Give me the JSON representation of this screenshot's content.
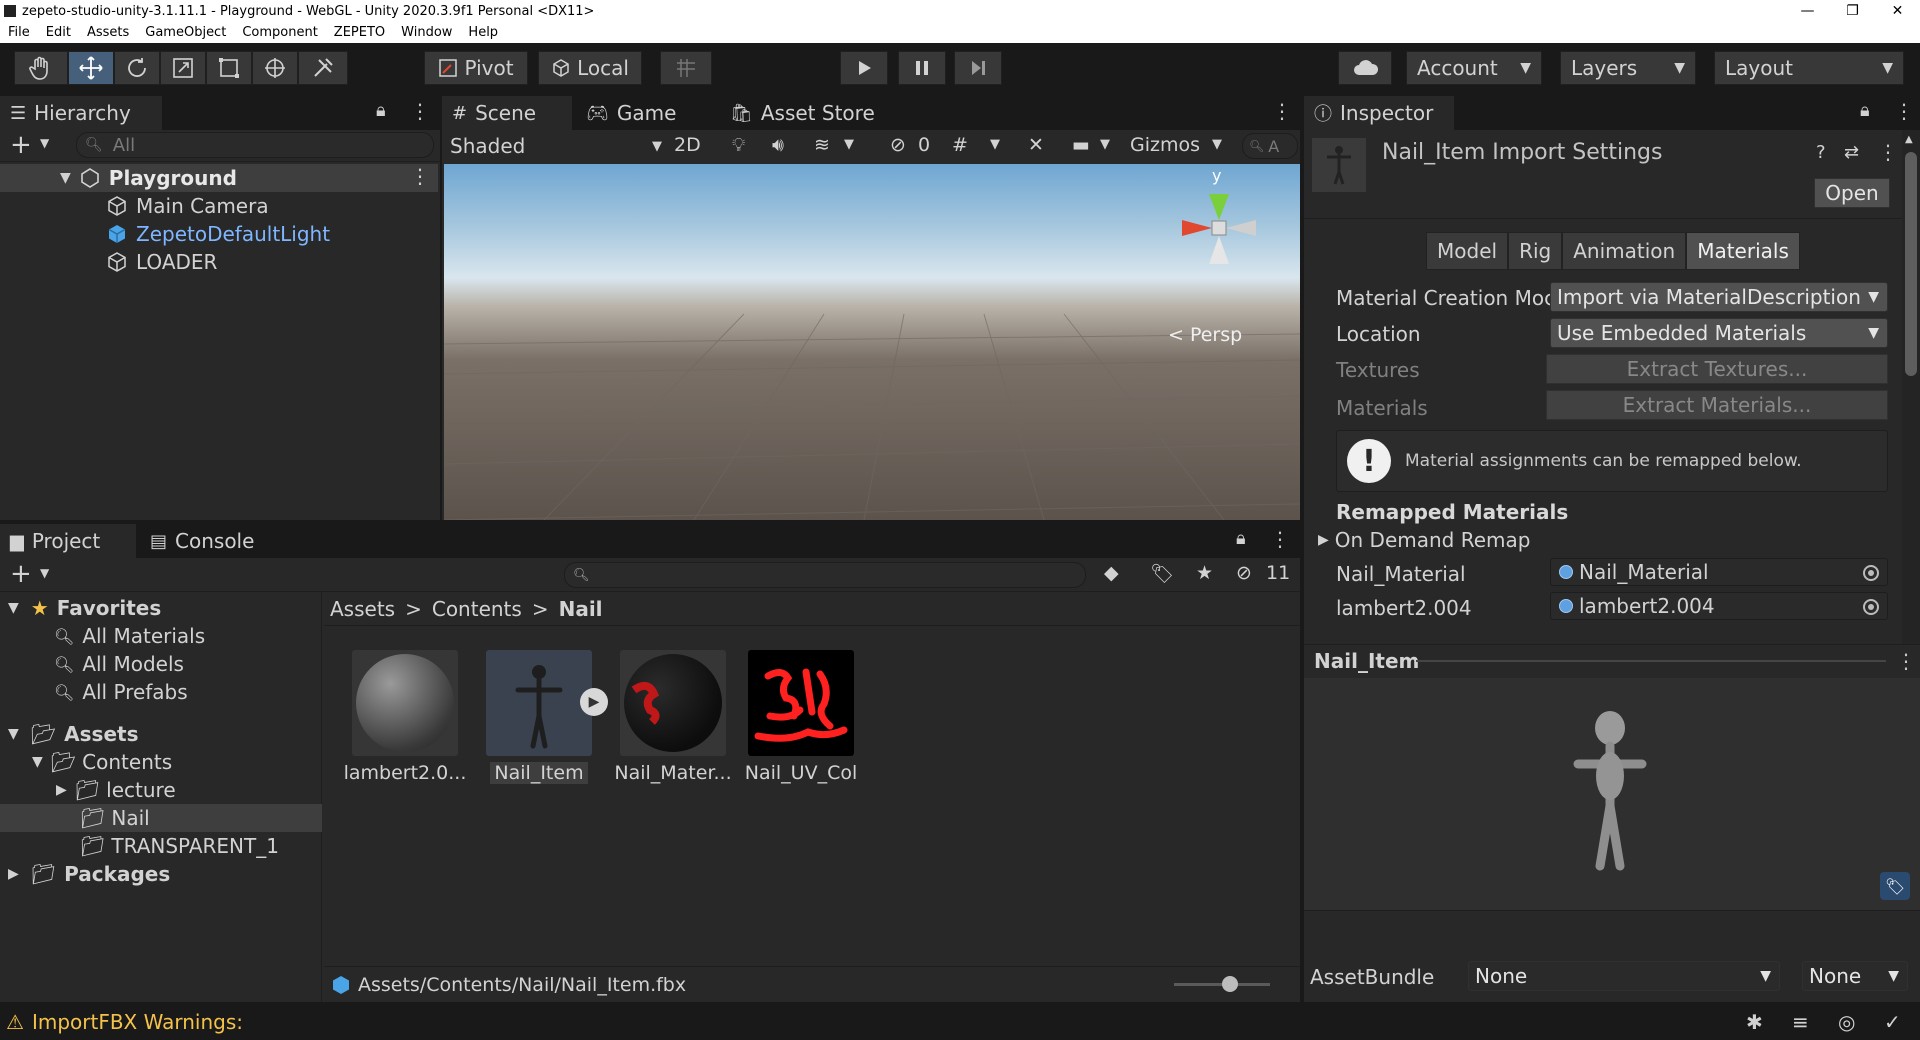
{
  "window": {
    "title": "zepeto-studio-unity-3.1.11.1 - Playground - WebGL - Unity 2020.3.9f1 Personal <DX11>",
    "minimize_glyph": "—",
    "restore_glyph": "❐",
    "close_glyph": "✕"
  },
  "menu": [
    "File",
    "Edit",
    "Assets",
    "GameObject",
    "Component",
    "ZEPETO",
    "Window",
    "Help"
  ],
  "toolbar": {
    "pivot_label": "Pivot",
    "local_label": "Local",
    "account_label": "Account",
    "layers_label": "Layers",
    "layout_label": "Layout"
  },
  "hierarchy": {
    "tab_label": "Hierarchy",
    "search_placeholder": "All",
    "scene_name": "Playground",
    "items": [
      "Main Camera",
      "ZepetoDefaultLight",
      "LOADER"
    ]
  },
  "scene": {
    "tabs": [
      "Scene",
      "Game",
      "Asset Store"
    ],
    "shading_mode": "Shaded",
    "mode_2d": "2D",
    "hidden_count": "0",
    "gizmos_label": "Gizmos",
    "search_fragment": "A",
    "axis_y": "y",
    "persp_label": "< Persp"
  },
  "project": {
    "tabs": [
      "Project",
      "Console"
    ],
    "hidden_count": "11",
    "favorites_label": "Favorites",
    "favorites": [
      "All Materials",
      "All Models",
      "All Prefabs"
    ],
    "assets_label": "Assets",
    "contents_label": "Contents",
    "folders": [
      "lecture",
      "Nail",
      "TRANSPARENT_1"
    ],
    "packages_label": "Packages",
    "breadcrumb": [
      "Assets",
      "Contents",
      "Nail"
    ],
    "breadcrumb_sep": ">",
    "asset_labels": [
      "lambert2.0...",
      "Nail_Item",
      "Nail_Mater...",
      "Nail_UV_Col"
    ],
    "footer_path": "Assets/Contents/Nail/Nail_Item.fbx"
  },
  "inspector": {
    "tab_label": "Inspector",
    "title": "Nail_Item Import Settings",
    "open_label": "Open",
    "subtabs": [
      "Model",
      "Rig",
      "Animation",
      "Materials"
    ],
    "material_creation_label": "Material Creation Moc",
    "material_creation_value": "Import via MaterialDescription",
    "location_label": "Location",
    "location_value": "Use Embedded Materials",
    "textures_label": "Textures",
    "extract_textures": "Extract Textures...",
    "materials_label": "Materials",
    "extract_materials": "Extract Materials...",
    "info_glyph": "!",
    "info_text": "Material assignments can be remapped below.",
    "remapped_header": "Remapped Materials",
    "on_demand_label": "On Demand Remap",
    "remaps": [
      {
        "label": "Nail_Material",
        "value": "Nail_Material"
      },
      {
        "label": "lambert2.004",
        "value": "lambert2.004"
      }
    ],
    "preview_title": "Nail_Item",
    "assetbundle_label": "AssetBundle",
    "assetbundle_value": "None",
    "assetbundle_variant": "None"
  },
  "status": {
    "warning_text": "ImportFBX Warnings:"
  },
  "colors": {
    "accent_selected": "#46607c",
    "link_blue": "#7fb6ff",
    "warning_yellow": "#f4c24a",
    "gizmo_red": "#e04830",
    "gizmo_green": "#7ad03a"
  }
}
